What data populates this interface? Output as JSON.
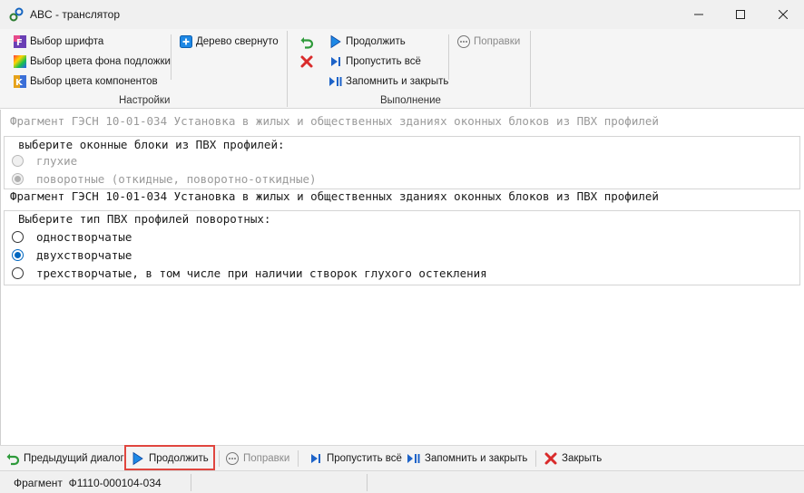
{
  "window": {
    "title": "ABC - транслятор"
  },
  "ribbon": {
    "settings": {
      "font_choice": "Выбор шрифта",
      "bg_color_choice": "Выбор цвета фона подложки",
      "component_color_choice": "Выбор цвета компонентов",
      "tree_collapsed": "Дерево свернуто",
      "group_label": "Настройки"
    },
    "execution": {
      "continue": "Продолжить",
      "skip_all": "Пропустить всё",
      "remember_close": "Запомнить и закрыть",
      "corrections": "Поправки",
      "group_label": "Выполнение"
    }
  },
  "content": {
    "fragment_1_title": "Фрагмент ГЭСН 10-01-034 Установка в жилых и общественных зданиях оконных блоков из ПВХ профилей",
    "group_1": {
      "legend": "выберите оконные блоки из ПВХ профилей:",
      "options": [
        "глухие",
        "поворотные (откидные, поворотно-откидные)"
      ],
      "selected_index": 1,
      "disabled": true
    },
    "fragment_2_title": "Фрагмент ГЭСН 10-01-034 Установка в жилых и общественных зданиях оконных блоков из ПВХ профилей",
    "group_2": {
      "legend": "Выберите тип ПВХ профилей поворотных:",
      "options": [
        "одностворчатые",
        "двухстворчатые",
        "трехстворчатые, в том числе при наличии створок глухого остекления"
      ],
      "selected_index": 1,
      "disabled": false
    }
  },
  "bottom_toolbar": {
    "prev_dialog": "Предыдущий диалог",
    "continue": "Продолжить",
    "corrections": "Поправки",
    "skip_all": "Пропустить всё",
    "remember_close": "Запомнить и закрыть",
    "close": "Закрыть"
  },
  "status": {
    "fragment_label": "Фрагмент",
    "fragment_code": "Ф1110-000104-034"
  },
  "colors": {
    "accent_blue": "#0067c0",
    "highlight_red": "#e0463f",
    "close_red": "#d92b2b",
    "back_green": "#2e9a3a"
  }
}
